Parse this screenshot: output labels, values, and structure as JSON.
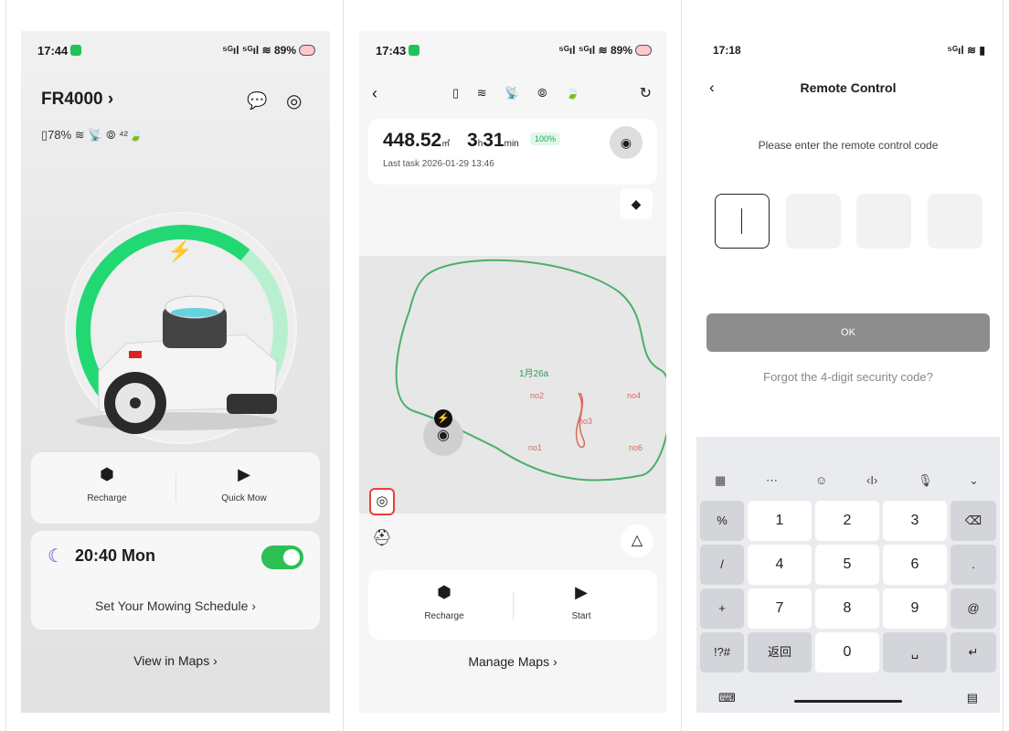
{
  "phone1": {
    "status_time": "17:44",
    "status_right": "⁵ᴳıl ⁵ᴳıl ≋ 89%",
    "title": "FR4000 ›",
    "stats": "▯78% ≋ 📡 ⦾ ⁴²🍃",
    "recharge_label": "Recharge",
    "quick_mow_label": "Quick Mow",
    "schedule_time": "20:40 Mon",
    "schedule_link": "Set Your Mowing Schedule ›",
    "view_maps": "View in Maps ›"
  },
  "phone2": {
    "status_time": "17:43",
    "status_right": "⁵ᴳıl ⁵ᴳıl ≋ 89%",
    "nav_icons": "▯ ≋ 📡 ⦾ 🍃",
    "area_value": "448.52",
    "area_unit": "㎡",
    "duration_hours": "3",
    "duration_minutes": "31",
    "completion": "100%",
    "last_task": "Last task  2026-01-29 13:46",
    "map_zone_label": "1月26a",
    "map_markers": [
      "no2",
      "no4",
      "no3",
      "no1",
      "no6"
    ],
    "recharge_label": "Recharge",
    "start_label": "Start",
    "manage_maps": "Manage Maps ›"
  },
  "phone3": {
    "status_time": "17:18",
    "status_right": "⁵ᴳıl ≋ ▮",
    "title": "Remote Control",
    "prompt": "Please enter the remote control code",
    "ok_label": "OK",
    "forgot_link": "Forgot the 4-digit security code?",
    "keys": {
      "k1": "1",
      "k2": "2",
      "k3": "3",
      "k4": "4",
      "k5": "5",
      "k6": "6",
      "k7": "7",
      "k8": "8",
      "k9": "9",
      "k0": "0",
      "percent": "%",
      "slash": "/",
      "plus": "+",
      "sym": "!?#",
      "cn_back": "返回",
      "dot": ".",
      "at": "@"
    }
  },
  "colors": {
    "accent_green": "#22d873",
    "toggle_green": "#2dbf51",
    "path_green": "#4caf6a",
    "marker_red": "#e8413b"
  }
}
